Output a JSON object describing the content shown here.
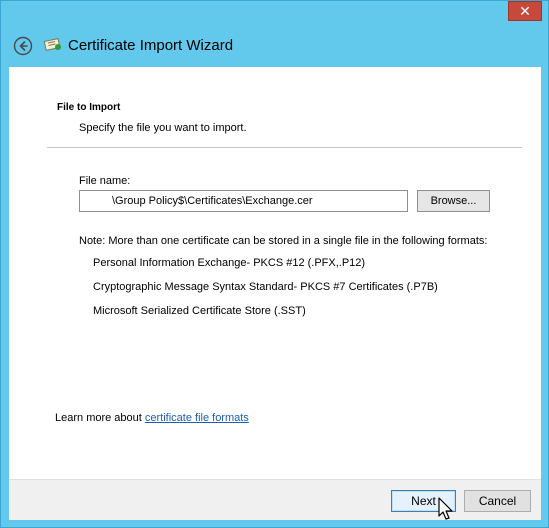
{
  "window": {
    "title": "Certificate Import Wizard",
    "close_glyph": "✕"
  },
  "section": {
    "title": "File to Import",
    "subtitle": "Specify the file you want to import."
  },
  "file": {
    "label": "File name:",
    "value": "\\Group Policy$\\Certificates\\Exchange.cer",
    "browse_label": "Browse..."
  },
  "note": {
    "text": "Note:  More than one certificate can be stored in a single file in the following formats:",
    "formats": [
      "Personal Information Exchange- PKCS #12 (.PFX,.P12)",
      "Cryptographic Message Syntax Standard- PKCS #7 Certificates (.P7B)",
      "Microsoft Serialized Certificate Store (.SST)"
    ]
  },
  "learn": {
    "prefix": "Learn more about ",
    "link_text": "certificate file formats"
  },
  "footer": {
    "next_label": "Next",
    "cancel_label": "Cancel"
  },
  "colors": {
    "titlebar": "#62c8ec",
    "close": "#c7493c",
    "link": "#1a5fb4"
  }
}
